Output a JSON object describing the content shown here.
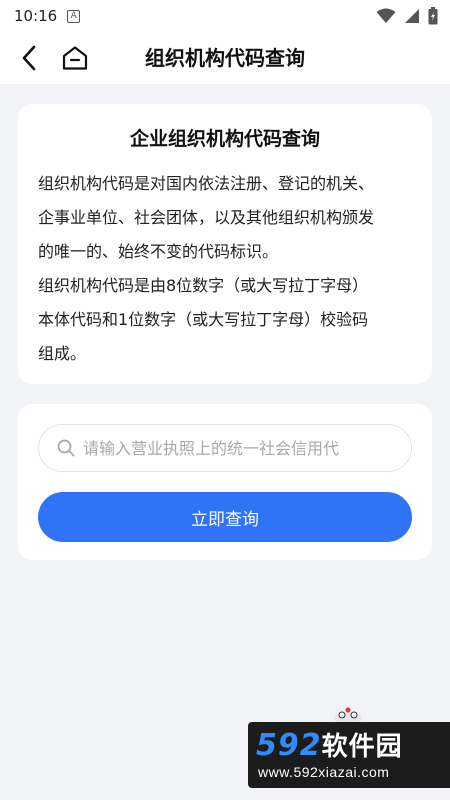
{
  "status_bar": {
    "time": "10:16",
    "notification_letter": "A"
  },
  "header": {
    "title": "组织机构代码查询",
    "back_icon": "chevron-left-icon",
    "home_icon": "home-icon"
  },
  "info_card": {
    "title": "企业组织机构代码查询",
    "text": "组织机构代码是对国内依法注册、登记的机关、\n企事业单位、社会团体，以及其他组织机构颁发\n的唯一的、始终不变的代码标识。\n组织机构代码是由8位数字（或大写拉丁字母）\n本体代码和1位数字（或大写拉丁字母）校验码\n组成。"
  },
  "query": {
    "placeholder": "请输入营业执照上的统一社会信用代",
    "value": "",
    "button_label": "立即查询"
  },
  "watermark": {
    "number": "592",
    "name": "软件园",
    "url": "www.592xiazai.com"
  },
  "colors": {
    "accent": "#2f74f7",
    "page_bg": "#f2f3f7",
    "card_bg": "#ffffff"
  }
}
